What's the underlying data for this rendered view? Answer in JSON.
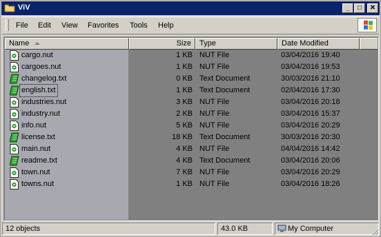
{
  "window": {
    "title": "ViV"
  },
  "titlebar_buttons": {
    "minimize": "_",
    "maximize": "□",
    "close": "✕"
  },
  "menu": [
    "File",
    "Edit",
    "View",
    "Favorites",
    "Tools",
    "Help"
  ],
  "columns": {
    "name": "Name",
    "size": "Size",
    "type": "Type",
    "date": "Date Modified"
  },
  "files": [
    {
      "name": "cargo.nut",
      "size": "1 KB",
      "type": "NUT File",
      "date": "03/04/2016 19:40",
      "icon": "nut"
    },
    {
      "name": "cargoes.nut",
      "size": "1 KB",
      "type": "NUT File",
      "date": "03/04/2016 19:53",
      "icon": "nut"
    },
    {
      "name": "changelog.txt",
      "size": "0 KB",
      "type": "Text Document",
      "date": "30/03/2016 21:10",
      "icon": "txt"
    },
    {
      "name": "english.txt",
      "size": "1 KB",
      "type": "Text Document",
      "date": "02/04/2016 17:30",
      "icon": "txt"
    },
    {
      "name": "industries.nut",
      "size": "3 KB",
      "type": "NUT File",
      "date": "03/04/2016 20:18",
      "icon": "nut"
    },
    {
      "name": "industry.nut",
      "size": "2 KB",
      "type": "NUT File",
      "date": "03/04/2016 15:37",
      "icon": "nut"
    },
    {
      "name": "info.nut",
      "size": "5 KB",
      "type": "NUT File",
      "date": "03/04/2016 20:29",
      "icon": "nut"
    },
    {
      "name": "license.txt",
      "size": "18 KB",
      "type": "Text Document",
      "date": "30/03/2016 20:30",
      "icon": "txt"
    },
    {
      "name": "main.nut",
      "size": "4 KB",
      "type": "NUT File",
      "date": "04/04/2016 14:42",
      "icon": "nut"
    },
    {
      "name": "readme.txt",
      "size": "4 KB",
      "type": "Text Document",
      "date": "03/04/2016 20:06",
      "icon": "txt"
    },
    {
      "name": "town.nut",
      "size": "7 KB",
      "type": "NUT File",
      "date": "03/04/2016 20:29",
      "icon": "nut"
    },
    {
      "name": "towns.nut",
      "size": "1 KB",
      "type": "NUT File",
      "date": "03/04/2016 18:26",
      "icon": "nut"
    }
  ],
  "focused_file": "english.txt",
  "status": {
    "objects": "12 objects",
    "size": "43.0 KB",
    "location": "My Computer"
  },
  "colors": {
    "titlebar": "#0a246a",
    "list_bg": "#808080",
    "name_column_bg": "#a8a8b0",
    "chrome": "#d4d0c8",
    "icon_green": "#22a022"
  }
}
